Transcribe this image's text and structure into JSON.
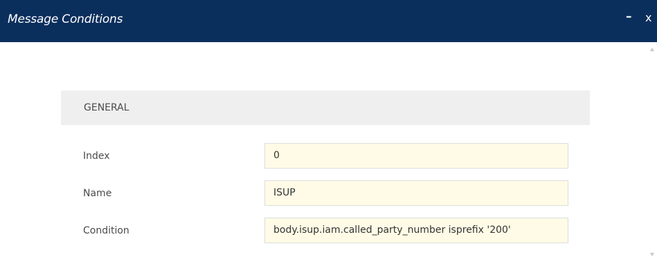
{
  "window": {
    "title": "Message Conditions",
    "minimize_glyph": "–",
    "close_glyph": "x"
  },
  "section": {
    "title": "GENERAL"
  },
  "fields": [
    {
      "label": "Index",
      "value": "0"
    },
    {
      "label": "Name",
      "value": "ISUP"
    },
    {
      "label": "Condition",
      "value": "body.isup.iam.called_party_number isprefix '200'"
    }
  ],
  "colors": {
    "titlebar": "#0b2f5d",
    "section_header_bg": "#efefef",
    "field_bg": "#fffbe6",
    "field_border": "#dddddd",
    "label_text": "#4a4a4a"
  },
  "icons": [
    "minimize-icon",
    "close-icon",
    "scroll-up-icon",
    "scroll-down-icon"
  ]
}
